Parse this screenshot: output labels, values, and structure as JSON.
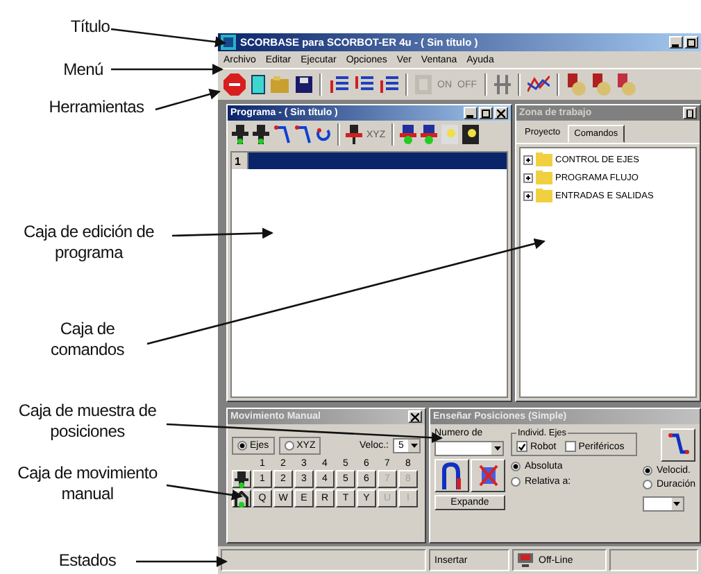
{
  "annotations": [
    {
      "text": "Título"
    },
    {
      "text": "Menú"
    },
    {
      "text": "Herramientas"
    },
    {
      "text": "Caja de edición de programa"
    },
    {
      "text": "Caja de comandos"
    },
    {
      "text": "Caja de muestra de posiciones"
    },
    {
      "text": "Caja de movimiento manual"
    },
    {
      "text": "Estados"
    }
  ],
  "window": {
    "title": "SCORBASE para SCORBOT-ER 4u - ( Sin título )"
  },
  "menu": [
    "Archivo",
    "Editar",
    "Ejecutar",
    "Opciones",
    "Ver",
    "Ventana",
    "Ayuda"
  ],
  "toolbar": {
    "on_label": "ON",
    "off_label": "OFF"
  },
  "program": {
    "title": "Programa - ( Sin título )",
    "xyz_label": "XYZ",
    "lines": [
      {
        "number": "1",
        "selected": true
      }
    ]
  },
  "workspace": {
    "title": "Zona de trabajo",
    "tabs": [
      {
        "label": "Proyecto",
        "selected": false
      },
      {
        "label": "Comandos",
        "selected": true
      }
    ],
    "tree": [
      {
        "label": "CONTROL DE EJES",
        "expanded": false
      },
      {
        "label": "PROGRAMA FLUJO",
        "expanded": false
      },
      {
        "label": "ENTRADAS E SALIDAS",
        "expanded": false
      }
    ]
  },
  "manual": {
    "title": "Movimiento Manual",
    "modes": [
      {
        "label": "Ejes",
        "selected": true
      },
      {
        "label": "XYZ",
        "selected": false
      }
    ],
    "speed_label": "Veloc.:",
    "speed": "5",
    "axis_numbers": [
      "1",
      "2",
      "3",
      "4",
      "5",
      "6",
      "7",
      "8"
    ],
    "plus_keys": [
      {
        "label": "1",
        "disabled": false
      },
      {
        "label": "2",
        "disabled": false
      },
      {
        "label": "3",
        "disabled": false
      },
      {
        "label": "4",
        "disabled": false
      },
      {
        "label": "5",
        "disabled": false
      },
      {
        "label": "6",
        "disabled": false
      },
      {
        "label": "7",
        "disabled": true
      },
      {
        "label": "8",
        "disabled": true
      }
    ],
    "minus_keys": [
      {
        "label": "Q",
        "disabled": false
      },
      {
        "label": "W",
        "disabled": false
      },
      {
        "label": "E",
        "disabled": false
      },
      {
        "label": "R",
        "disabled": false
      },
      {
        "label": "T",
        "disabled": false
      },
      {
        "label": "Y",
        "disabled": false
      },
      {
        "label": "U",
        "disabled": true
      },
      {
        "label": "I",
        "disabled": true
      }
    ]
  },
  "teach": {
    "title": "Enseñar Posiciones (Simple)",
    "number_label": "Numero de",
    "group_label": "Individ. Ejes",
    "checks": [
      {
        "label": "Robot",
        "checked": true
      },
      {
        "label": "Periféricos",
        "checked": false
      }
    ],
    "record_button": "Expande",
    "coord_modes": [
      {
        "label": "Absoluta",
        "selected": true
      },
      {
        "label": "Relativa a:",
        "selected": false
      }
    ],
    "speed_modes": [
      {
        "label": "Velocid.",
        "selected": true
      },
      {
        "label": "Duración",
        "selected": false
      }
    ]
  },
  "status_bar": {
    "mode": "Insertar",
    "connection": "Off-Line"
  }
}
